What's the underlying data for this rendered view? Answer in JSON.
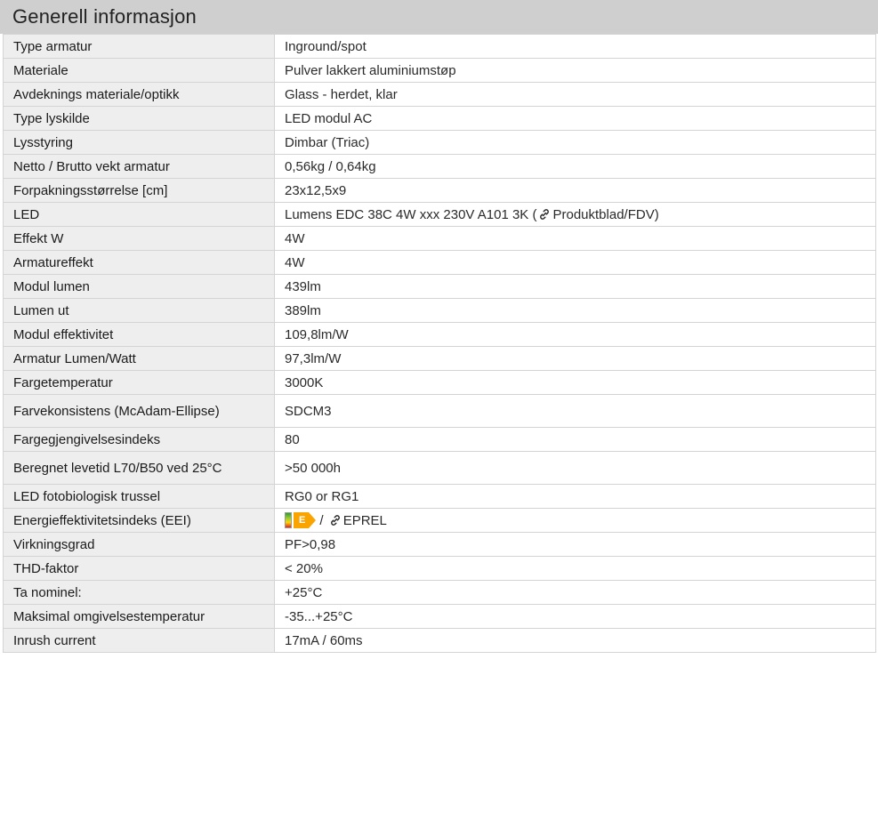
{
  "header": {
    "title": "Generell informasjon"
  },
  "rows": [
    {
      "label": "Type armatur",
      "value": "Inground/spot"
    },
    {
      "label": "Materiale",
      "value": "Pulver lakkert aluminiumstøp"
    },
    {
      "label": "Avdeknings materiale/optikk",
      "value": "Glass - herdet, klar"
    },
    {
      "label": "Type lyskilde",
      "value": "LED modul AC"
    },
    {
      "label": "Lysstyring",
      "value": "Dimbar (Triac)"
    },
    {
      "label": "Netto / Brutto vekt armatur",
      "value": "0,56kg / 0,64kg"
    },
    {
      "label": "Forpakningsstørrelse [cm]",
      "value": "23x12,5x9"
    },
    {
      "label": "LED",
      "value": "Lumens EDC 38C 4W xxx 230V A101 3K (",
      "link_text": "Produktblad/FDV",
      "suffix": ")"
    },
    {
      "label": "Effekt W",
      "value": "4W"
    },
    {
      "label": "Armatureffekt",
      "value": "4W"
    },
    {
      "label": "Modul lumen",
      "value": "439lm"
    },
    {
      "label": "Lumen ut",
      "value": "389lm"
    },
    {
      "label": "Modul effektivitet",
      "value": "109,8lm/W"
    },
    {
      "label": "Armatur Lumen/Watt",
      "value": "97,3lm/W"
    },
    {
      "label": "Fargetemperatur",
      "value": "3000K"
    },
    {
      "label": "Farvekonsistens (McAdam-Ellipse)",
      "value": "SDCM3"
    },
    {
      "label": "Fargegjengivelsesindeks",
      "value": "80"
    },
    {
      "label": "Beregnet levetid L70/B50 ved 25°C",
      "value": ">50 000h"
    },
    {
      "label": "LED fotobiologisk trussel",
      "value": "RG0 or RG1"
    },
    {
      "label": "Energieffektivitetsindeks (EEI)",
      "energy_class": "E",
      "separator": "/",
      "link_text": "EPREL"
    },
    {
      "label": "Virkningsgrad",
      "value": "PF>0,98"
    },
    {
      "label": "THD-faktor",
      "value": "< 20%"
    },
    {
      "label": "Ta nominel:",
      "value": "+25°C"
    },
    {
      "label": "Maksimal omgivelsestemperatur",
      "value": "-35...+25°C"
    },
    {
      "label": "Inrush current",
      "value": "17mA / 60ms"
    }
  ],
  "colors": {
    "header_bg": "#cfcfcf",
    "label_bg": "#eeeeee",
    "value_bg": "#ffffff",
    "border": "#d4d4d4",
    "energy_arrow": "#f9a400"
  },
  "icons": {
    "link": "link-icon",
    "energy": "energy-label-icon"
  }
}
